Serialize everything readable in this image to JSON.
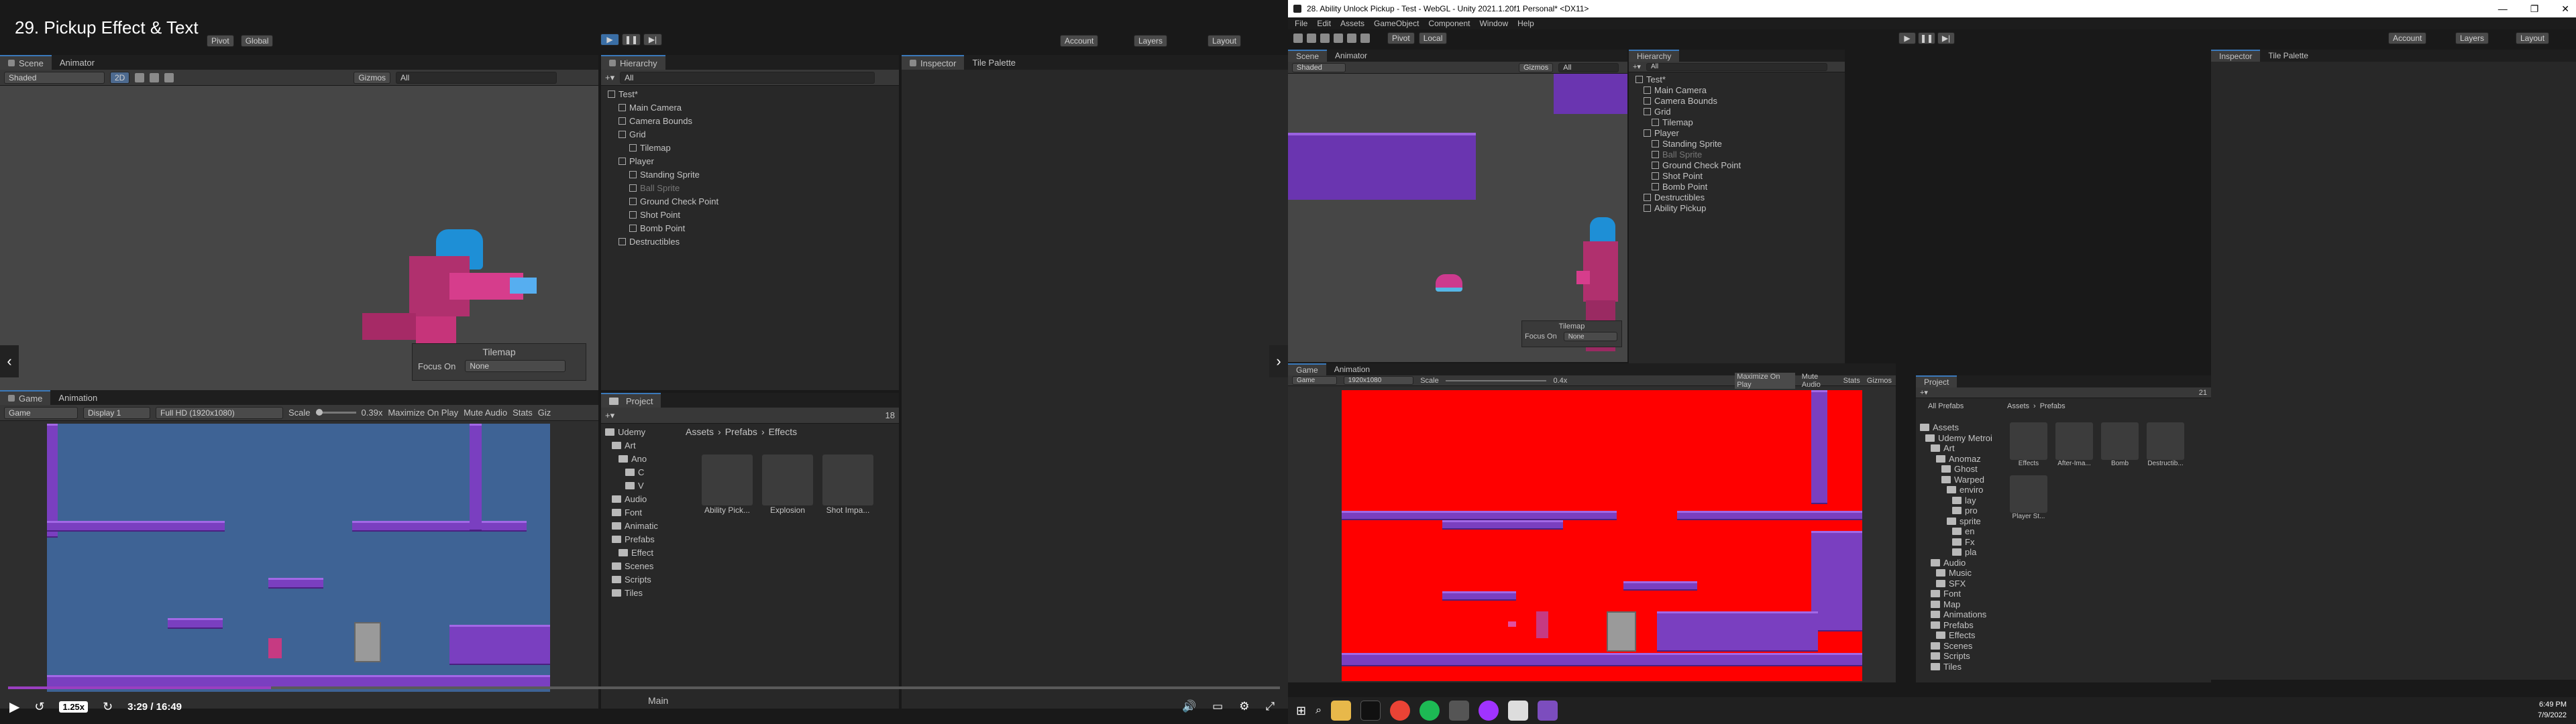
{
  "left": {
    "video_title": "29. Pickup Effect & Text",
    "toolbar": {
      "pivot": "Pivot",
      "global": "Global",
      "account": "Account",
      "layers": "Layers",
      "layout": "Layout"
    },
    "scene_tabs": [
      "Scene",
      "Animator"
    ],
    "scene_toolbar": {
      "shaded": "Shaded",
      "mode2d": "2D",
      "gizmos": "Gizmos",
      "search": "All"
    },
    "tilemap_overlay": {
      "title": "Tilemap",
      "focus_label": "Focus On",
      "focus_value": "None"
    },
    "hierarchy": {
      "tab": "Hierarchy",
      "search": "All",
      "items": [
        {
          "label": "Test*",
          "depth": 0,
          "type": "scene"
        },
        {
          "label": "Main Camera",
          "depth": 1,
          "type": "obj"
        },
        {
          "label": "Camera Bounds",
          "depth": 1,
          "type": "obj"
        },
        {
          "label": "Grid",
          "depth": 1,
          "type": "obj"
        },
        {
          "label": "Tilemap",
          "depth": 2,
          "type": "obj"
        },
        {
          "label": "Player",
          "depth": 1,
          "type": "obj"
        },
        {
          "label": "Standing Sprite",
          "depth": 2,
          "type": "obj"
        },
        {
          "label": "Ball Sprite",
          "depth": 2,
          "type": "disabled"
        },
        {
          "label": "Ground Check Point",
          "depth": 2,
          "type": "obj"
        },
        {
          "label": "Shot Point",
          "depth": 2,
          "type": "obj"
        },
        {
          "label": "Bomb Point",
          "depth": 2,
          "type": "obj"
        },
        {
          "label": "Destructibles",
          "depth": 1,
          "type": "obj"
        }
      ]
    },
    "inspector_tabs": [
      "Inspector",
      "Tile Palette"
    ],
    "game_tabs": [
      "Game",
      "Animation"
    ],
    "game_toolbar": {
      "mode": "Game",
      "display": "Display 1",
      "resolution": "Full HD (1920x1080)",
      "scale_label": "Scale",
      "scale_value": "0.39x",
      "maximize": "Maximize On Play",
      "mute": "Mute Audio",
      "stats": "Stats",
      "gizmos": "Giz"
    },
    "project": {
      "tab": "Project",
      "count": "18",
      "breadcrumb": [
        "Assets",
        "Prefabs",
        "Effects"
      ],
      "folders": [
        {
          "label": "Udemy",
          "depth": 0
        },
        {
          "label": "Art",
          "depth": 1
        },
        {
          "label": "Ano",
          "depth": 2
        },
        {
          "label": "C",
          "depth": 3
        },
        {
          "label": "V",
          "depth": 3
        },
        {
          "label": "Audio",
          "depth": 1
        },
        {
          "label": "Font",
          "depth": 1
        },
        {
          "label": "Animatic",
          "depth": 1
        },
        {
          "label": "Prefabs",
          "depth": 1
        },
        {
          "label": "Effect",
          "depth": 2
        },
        {
          "label": "Scenes",
          "depth": 1
        },
        {
          "label": "Scripts",
          "depth": 1
        },
        {
          "label": "Tiles",
          "depth": 1
        }
      ],
      "assets": [
        "Ability Pick...",
        "Explosion",
        "Shot Impa..."
      ],
      "footer": "Main"
    },
    "player": {
      "speed": "1.25x",
      "time": "3:29 / 16:49",
      "progress": 0.207
    }
  },
  "right": {
    "window_title": "28. Ability Unlock Pickup - Test - WebGL - Unity 2021.1.20f1 Personal* <DX11>",
    "menu": [
      "File",
      "Edit",
      "Assets",
      "GameObject",
      "Component",
      "Window",
      "Help"
    ],
    "toolbar": {
      "pivot": "Pivot",
      "local": "Local",
      "account": "Account",
      "layers": "Layers",
      "layout": "Layout"
    },
    "scene_tabs": [
      "Scene",
      "Animator"
    ],
    "scene_toolbar": {
      "shaded": "Shaded",
      "gizmos": "Gizmos",
      "search": "All"
    },
    "tilemap_overlay": {
      "title": "Tilemap",
      "focus_label": "Focus On",
      "focus_value": "None"
    },
    "hierarchy": {
      "tab": "Hierarchy",
      "search": "All",
      "items": [
        {
          "label": "Test*",
          "depth": 0,
          "type": "scene"
        },
        {
          "label": "Main Camera",
          "depth": 1,
          "type": "obj"
        },
        {
          "label": "Camera Bounds",
          "depth": 1,
          "type": "obj"
        },
        {
          "label": "Grid",
          "depth": 1,
          "type": "obj"
        },
        {
          "label": "Tilemap",
          "depth": 2,
          "type": "obj"
        },
        {
          "label": "Player",
          "depth": 1,
          "type": "obj"
        },
        {
          "label": "Standing Sprite",
          "depth": 2,
          "type": "obj"
        },
        {
          "label": "Ball Sprite",
          "depth": 2,
          "type": "disabled"
        },
        {
          "label": "Ground Check Point",
          "depth": 2,
          "type": "obj"
        },
        {
          "label": "Shot Point",
          "depth": 2,
          "type": "obj"
        },
        {
          "label": "Bomb Point",
          "depth": 2,
          "type": "obj"
        },
        {
          "label": "Destructibles",
          "depth": 1,
          "type": "obj"
        },
        {
          "label": "Ability Pickup",
          "depth": 1,
          "type": "obj"
        }
      ]
    },
    "inspector_tabs": [
      "Inspector",
      "Tile Palette"
    ],
    "game_tabs": [
      "Game",
      "Animation"
    ],
    "game_toolbar": {
      "mode": "Game",
      "resolution": "1920x1080",
      "scale_label": "Scale",
      "scale_value": "0.4x",
      "maximize": "Maximize On Play",
      "mute": "Mute Audio",
      "stats": "Stats",
      "gizmos": "Gizmos"
    },
    "project": {
      "tab": "Project",
      "count": "21",
      "breadcrumb": [
        "Assets",
        "Prefabs"
      ],
      "favorites": "All Prefabs",
      "folders": [
        {
          "label": "Assets",
          "depth": 0
        },
        {
          "label": "Udemy Metroi",
          "depth": 1
        },
        {
          "label": "Art",
          "depth": 2
        },
        {
          "label": "Anomaz",
          "depth": 3
        },
        {
          "label": "Ghost",
          "depth": 4
        },
        {
          "label": "Warped",
          "depth": 4
        },
        {
          "label": "enviro",
          "depth": 5
        },
        {
          "label": "lay",
          "depth": 6
        },
        {
          "label": "pro",
          "depth": 6
        },
        {
          "label": "sprite",
          "depth": 5
        },
        {
          "label": "en",
          "depth": 6
        },
        {
          "label": "Fx",
          "depth": 6
        },
        {
          "label": "pla",
          "depth": 6
        },
        {
          "label": "Audio",
          "depth": 2
        },
        {
          "label": "Music",
          "depth": 3
        },
        {
          "label": "SFX",
          "depth": 3
        },
        {
          "label": "Font",
          "depth": 2
        },
        {
          "label": "Map",
          "depth": 2
        },
        {
          "label": "Animations",
          "depth": 2
        },
        {
          "label": "Prefabs",
          "depth": 2
        },
        {
          "label": "Effects",
          "depth": 3
        },
        {
          "label": "Scenes",
          "depth": 2
        },
        {
          "label": "Scripts",
          "depth": 2
        },
        {
          "label": "Tiles",
          "depth": 2
        }
      ],
      "assets": [
        "Effects",
        "After-Ima...",
        "Bomb",
        "Destructib...",
        "Player St..."
      ]
    },
    "taskbar": {
      "time": "6:49 PM",
      "date": "7/9/2022"
    }
  }
}
